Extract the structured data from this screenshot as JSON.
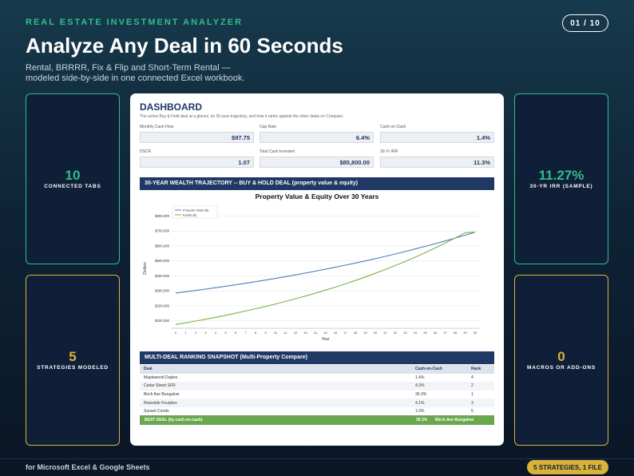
{
  "header": {
    "eyebrow": "REAL ESTATE INVESTMENT ANALYZER",
    "page_indicator": "01 / 10",
    "title": "Analyze Any Deal in 60 Seconds",
    "subtitle": "Rental, BRRRR, Fix & Flip and Short-Term Rental — modeled side-by-side in one connected Excel workbook."
  },
  "stats": {
    "tabs": {
      "value": "10",
      "label": "CONNECTED TABS"
    },
    "strategies": {
      "value": "5",
      "label": "STRATEGIES MODELED"
    },
    "irr": {
      "value": "11.27%",
      "label": "30-YR IRR (SAMPLE)"
    },
    "macros": {
      "value": "0",
      "label": "MACROS OR ADD-ONS"
    }
  },
  "dashboard": {
    "title": "DASHBOARD",
    "subtitle": "The active Buy & Hold deal at a glance, its 30-year trajectory, and how it ranks against the other deals on Compare.",
    "metrics": [
      {
        "label": "Monthly Cash Flow",
        "value": "$97.75"
      },
      {
        "label": "Cap Rate",
        "value": "6.4%"
      },
      {
        "label": "Cash-on-Cash",
        "value": "1.4%"
      },
      {
        "label": "DSCR",
        "value": "1.07"
      },
      {
        "label": "Total Cash Invested",
        "value": "$85,800.00"
      },
      {
        "label": "30-Yr IRR",
        "value": "11.3%"
      }
    ],
    "trajectory_heading": "30-YEAR WEALTH TRAJECTORY -- BUY & HOLD DEAL (property value & equity)",
    "ranking_heading": "MULTI-DEAL RANKING SNAPSHOT (Multi-Property Compare)",
    "ranking_columns": [
      "Deal",
      "Cash-on-Cash",
      "Rank"
    ],
    "ranking_rows": [
      [
        "Maplewood Duplex",
        "1.4%",
        "4"
      ],
      [
        "Cedar Street SFR",
        "4.3%",
        "2"
      ],
      [
        "Birch Ave Bungalow",
        "39.3%",
        "1"
      ],
      [
        "Riverside Fourplex",
        "4.1%",
        "3"
      ],
      [
        "Sunset Condo",
        "1.0%",
        "5"
      ]
    ],
    "best_deal": {
      "label": "BEST DEAL (by cash-on-cash)",
      "value": "39.3%",
      "name": "Birch Ave Bungalow"
    }
  },
  "chart_data": {
    "type": "line",
    "title": "Property Value & Equity Over 30 Years",
    "xlabel": "Year",
    "ylabel": "Dollars",
    "x": [
      0,
      1,
      2,
      3,
      4,
      5,
      6,
      7,
      8,
      9,
      10,
      11,
      12,
      13,
      14,
      15,
      16,
      17,
      18,
      19,
      20,
      21,
      22,
      23,
      24,
      25,
      26,
      27,
      28,
      29,
      30
    ],
    "ylim": [
      50000,
      850000
    ],
    "yticks": [
      "$100,000",
      "$200,000",
      "$300,000",
      "$400,000",
      "$500,000",
      "$600,000",
      "$700,000",
      "$800,000"
    ],
    "ytick_values": [
      100000,
      200000,
      300000,
      400000,
      500000,
      600000,
      700000,
      800000
    ],
    "legend_position": "top-left",
    "grid": true,
    "series": [
      {
        "name": "Property Value ($)",
        "color": "#4a7ebb",
        "values": [
          285000,
          293500,
          302300,
          311400,
          320700,
          330300,
          340300,
          350500,
          361000,
          371800,
          383000,
          394500,
          406300,
          418500,
          431100,
          444000,
          457300,
          471100,
          485200,
          499800,
          514800,
          530200,
          546100,
          562500,
          579400,
          596800,
          614700,
          633100,
          652100,
          671600,
          691800
        ]
      },
      {
        "name": "Equity ($)",
        "color": "#7cb342",
        "values": [
          75000,
          86400,
          98200,
          110500,
          123300,
          136600,
          150500,
          165000,
          180100,
          195800,
          212100,
          229100,
          246800,
          265200,
          284300,
          304200,
          324900,
          346500,
          369000,
          392400,
          416700,
          442000,
          468500,
          496000,
          524700,
          554700,
          585900,
          618500,
          652400,
          687900,
          691800
        ]
      }
    ]
  },
  "footer": {
    "left_text": "for Microsoft Excel & Google Sheets",
    "badge": "5 STRATEGIES, 1 FILE"
  }
}
